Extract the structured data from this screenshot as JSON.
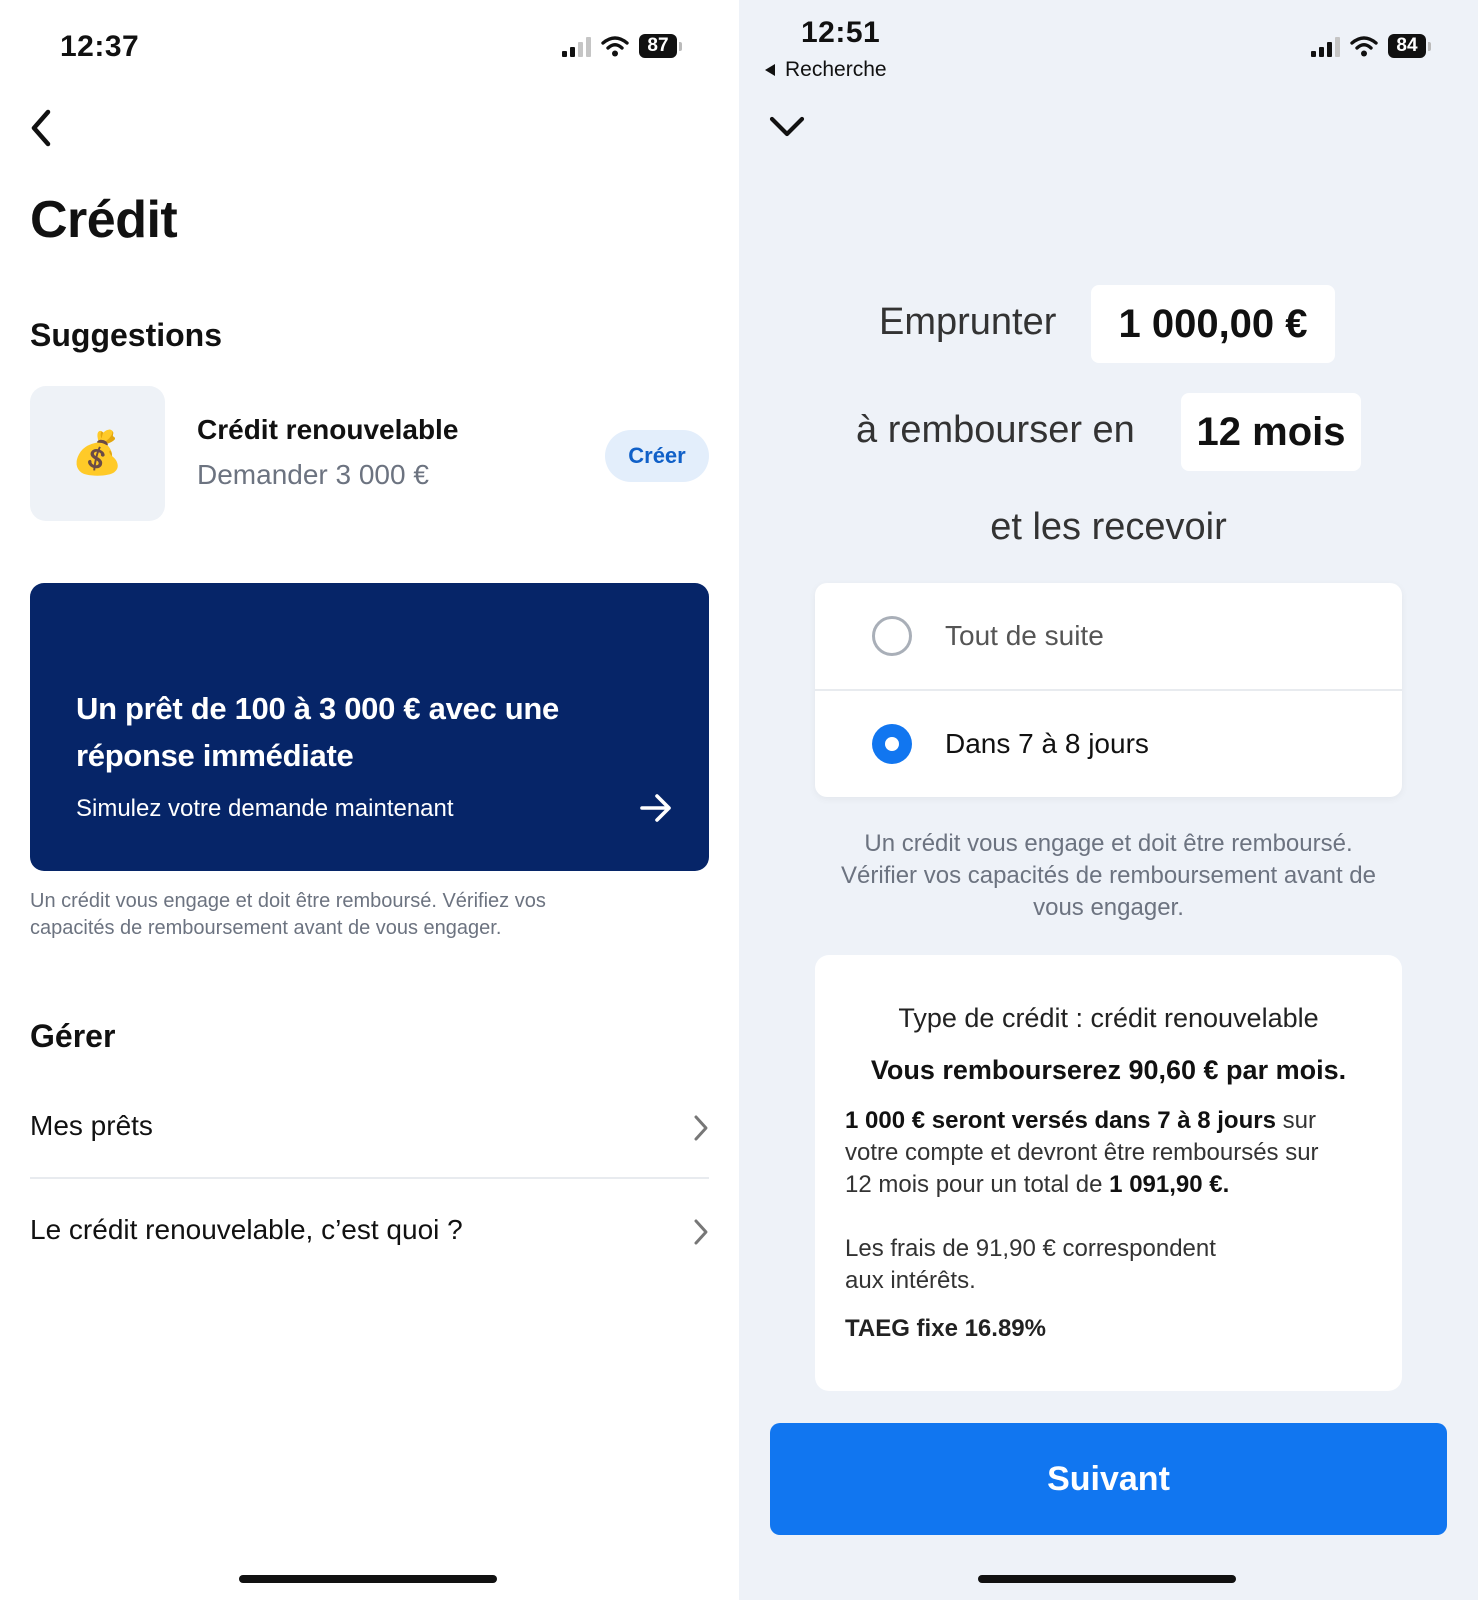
{
  "left": {
    "status": {
      "time": "12:37",
      "battery": "87"
    },
    "title": "Crédit",
    "suggestions": {
      "heading": "Suggestions",
      "item": {
        "icon": "money-bag-icon",
        "emoji": "💰",
        "title": "Crédit renouvelable",
        "subtitle": "Demander 3 000 €",
        "action": "Créer"
      }
    },
    "promo": {
      "title_line1": "Un prêt de 100 à 3 000 € avec une",
      "title_line2": "réponse immédiate",
      "subtitle": "Simulez votre demande maintenant",
      "arrow_icon": "arrow-right-icon"
    },
    "disclaimer_line1": "Un crédit vous engage et doit être remboursé. Vérifiez vos",
    "disclaimer_line2": "capacités de remboursement avant de vous engager.",
    "manage": {
      "heading": "Gérer",
      "rows": [
        {
          "label": "Mes prêts"
        },
        {
          "label": "Le crédit renouvelable, c’est quoi ?"
        }
      ]
    }
  },
  "right": {
    "status": {
      "time": "12:51",
      "battery": "84",
      "back_label": "Recherche"
    },
    "borrow_label": "Emprunter",
    "amount": "1 000,00 €",
    "repay_label": "à rembourser en",
    "duration": "12 mois",
    "receive_label": "et les recevoir",
    "options": [
      {
        "label": "Tout de suite",
        "selected": false
      },
      {
        "label": "Dans 7 à 8 jours",
        "selected": true
      }
    ],
    "disclaimer_line1": "Un crédit vous engage et doit être remboursé.",
    "disclaimer_line2": "Vérifier vos capacités de remboursement avant de",
    "disclaimer_line3": "vous engager.",
    "summary": {
      "type": "Type de crédit : crédit renouvelable",
      "monthly": "Vous rembourserez 90,60 € par mois.",
      "p1_bold1": "1 000 € seront versés dans 7 à 8 jours",
      "p1_text1": " sur",
      "p1_line2": "votre compte et devront être remboursés sur",
      "p1_text3": "12 mois pour un total de ",
      "p1_bold2": "1 091,90 €.",
      "fees_line1": "Les frais de 91,90 € correspondent",
      "fees_line2": "aux intérêts.",
      "taeg": "TAEG fixe 16.89%"
    },
    "button": "Suivant"
  },
  "colors": {
    "primary": "#1176f0",
    "promo_bg": "#062568",
    "right_bg": "#eef2f8",
    "muted": "#6c7380"
  }
}
